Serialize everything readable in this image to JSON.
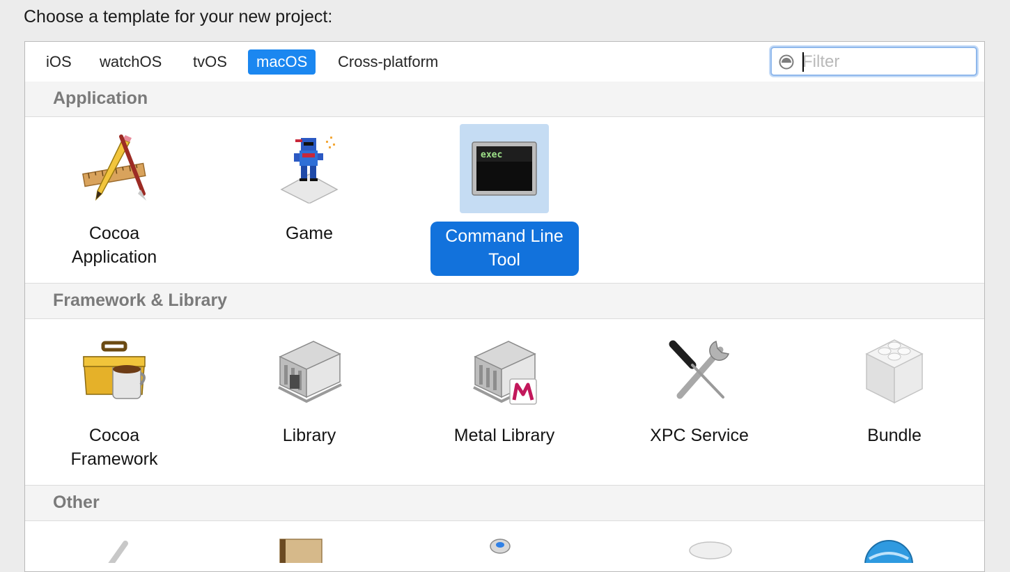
{
  "heading": "Choose a template for your new project:",
  "tabs": [
    "iOS",
    "watchOS",
    "tvOS",
    "macOS",
    "Cross-platform"
  ],
  "active_tab": "macOS",
  "filter": {
    "placeholder": "Filter",
    "value": ""
  },
  "sections": {
    "application": {
      "title": "Application",
      "items": [
        "Cocoa\nApplication",
        "Game",
        "Command Line\nTool"
      ],
      "selected": "Command Line Tool"
    },
    "framework": {
      "title": "Framework & Library",
      "items": [
        "Cocoa\nFramework",
        "Library",
        "Metal Library",
        "XPC Service",
        "Bundle"
      ]
    },
    "other": {
      "title": "Other"
    }
  },
  "icons": {
    "filter": "filter-icon",
    "cocoa_application": "pencil-ruler-icon",
    "game": "pixel-ninja-icon",
    "command_line_tool": "terminal-exec-icon",
    "cocoa_framework": "toolbox-coffee-icon",
    "library": "library-building-icon",
    "metal_library": "metal-library-icon",
    "xpc_service": "wrench-screwdriver-icon",
    "bundle": "bundle-brick-icon"
  },
  "terminal_text": "exec",
  "colors": {
    "accent": "#1b87f0",
    "selection": "#1272dc",
    "selection_bg": "#c5dcf3"
  }
}
